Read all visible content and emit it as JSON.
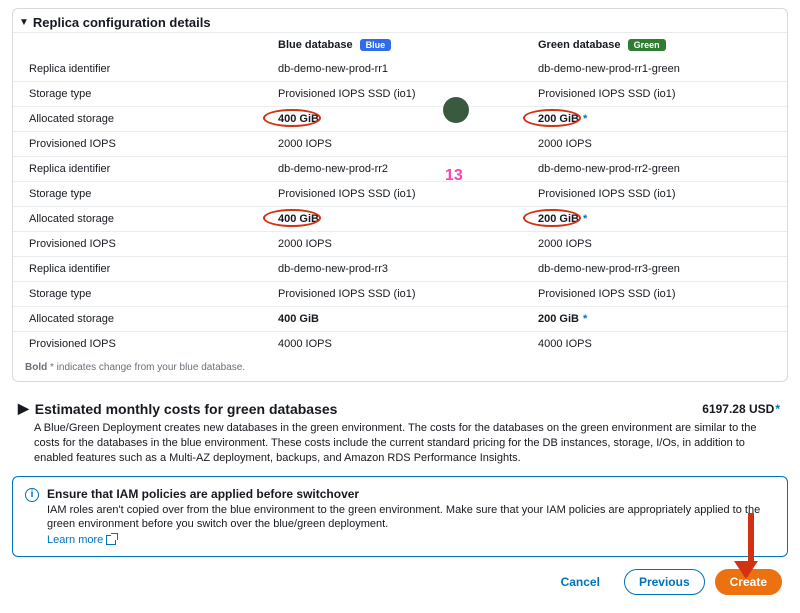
{
  "replica_panel": {
    "title": "Replica configuration details",
    "headers": {
      "label": "",
      "blue": "Blue database",
      "green": "Green database"
    },
    "badges": {
      "blue": "Blue",
      "green": "Green"
    },
    "hint_prefix": "Bold",
    "hint_rest": " * indicates change from your blue database.",
    "rows": [
      {
        "label": "Replica identifier",
        "blue": "db-demo-new-prod-rr1",
        "green": "db-demo-new-prod-rr1-green",
        "bold": false
      },
      {
        "label": "Storage type",
        "blue": "Provisioned IOPS SSD (io1)",
        "green": "Provisioned IOPS SSD (io1)",
        "bold": false
      },
      {
        "label": "Allocated storage",
        "blue": "400 GiB",
        "green": "200 GiB",
        "bold": true,
        "changed": true,
        "circled": true
      },
      {
        "label": "Provisioned IOPS",
        "blue": "2000 IOPS",
        "green": "2000 IOPS",
        "bold": false
      },
      {
        "label": "Replica identifier",
        "blue": "db-demo-new-prod-rr2",
        "green": "db-demo-new-prod-rr2-green",
        "bold": false
      },
      {
        "label": "Storage type",
        "blue": "Provisioned IOPS SSD (io1)",
        "green": "Provisioned IOPS SSD (io1)",
        "bold": false
      },
      {
        "label": "Allocated storage",
        "blue": "400 GiB",
        "green": "200 GiB",
        "bold": true,
        "changed": true,
        "circled": true
      },
      {
        "label": "Provisioned IOPS",
        "blue": "2000 IOPS",
        "green": "2000 IOPS",
        "bold": false
      },
      {
        "label": "Replica identifier",
        "blue": "db-demo-new-prod-rr3",
        "green": "db-demo-new-prod-rr3-green",
        "bold": false
      },
      {
        "label": "Storage type",
        "blue": "Provisioned IOPS SSD (io1)",
        "green": "Provisioned IOPS SSD (io1)",
        "bold": false
      },
      {
        "label": "Allocated storage",
        "blue": "400 GiB",
        "green": "200 GiB",
        "bold": true,
        "changed": true,
        "circled": false
      },
      {
        "label": "Provisioned IOPS",
        "blue": "4000 IOPS",
        "green": "4000 IOPS",
        "bold": false
      }
    ]
  },
  "annotations": {
    "step_number": "13"
  },
  "costs_panel": {
    "title": "Estimated monthly costs for green databases",
    "value": "6197.28 USD",
    "changed": true,
    "description": "A Blue/Green Deployment creates new databases in the green environment. The costs for the databases on the green environment are similar to the costs for the databases in the blue environment. These costs include the current standard pricing for the DB instances, storage, I/Os, in addition to enabled features such as a Multi-AZ deployment, backups, and Amazon RDS Performance Insights."
  },
  "info_box": {
    "title": "Ensure that IAM policies are applied before switchover",
    "text": "IAM roles aren't copied over from the blue environment to the green environment. Make sure that your IAM policies are appropriately applied to the green environment before you switch over the blue/green deployment.",
    "learn_more": "Learn more"
  },
  "actions": {
    "cancel": "Cancel",
    "previous": "Previous",
    "create": "Create"
  }
}
